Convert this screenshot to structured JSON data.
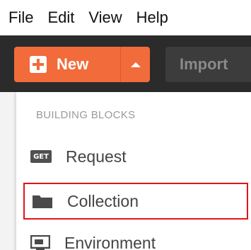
{
  "menubar": {
    "items": [
      "File",
      "Edit",
      "View",
      "Help"
    ]
  },
  "toolbar": {
    "new_label": "New",
    "import_label": "Import",
    "accent_color": "#f26b3a"
  },
  "dropdown": {
    "section_title": "BUILDING BLOCKS",
    "items": [
      {
        "label": "Request",
        "icon": "get-request-icon",
        "badge": "GET"
      },
      {
        "label": "Collection",
        "icon": "folder-icon",
        "highlighted": true
      },
      {
        "label": "Environment",
        "icon": "environment-icon"
      }
    ],
    "highlight_color": "#e3131b"
  }
}
